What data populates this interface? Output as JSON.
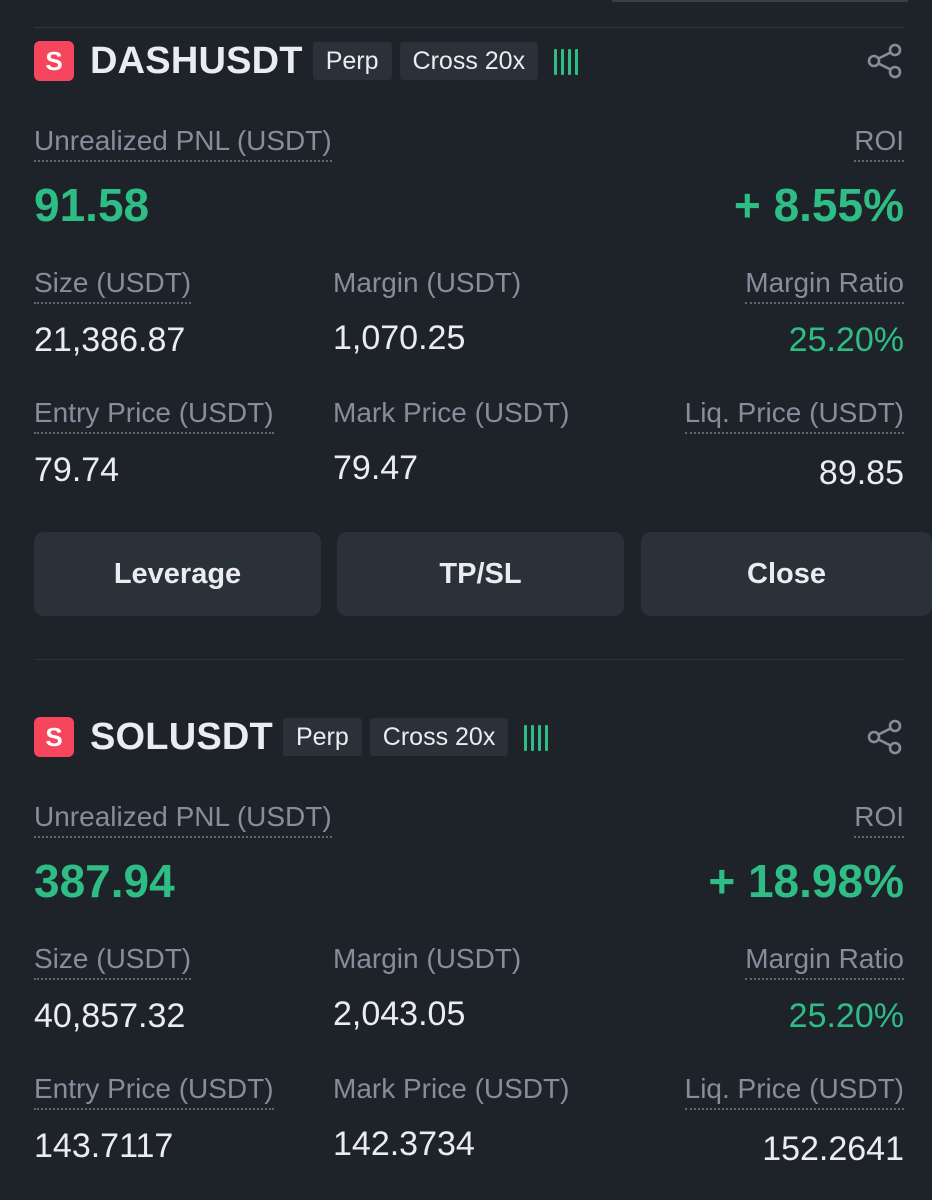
{
  "colors": {
    "background": "#1e2329",
    "positive": "#2ebd85",
    "short_badge": "#f6465d",
    "label": "#848e9c",
    "chip": "#2b3139"
  },
  "positions": [
    {
      "side": "S",
      "symbol": "DASHUSDT",
      "type_tag": "Perp",
      "margin_tag": "Cross 20x",
      "signal_bars": 4,
      "share_icon": "share-icon",
      "pnl_label": "Unrealized PNL (USDT)",
      "pnl": "91.58",
      "roi_label": "ROI",
      "roi": "+ 8.55%",
      "size_label": "Size (USDT)",
      "size": "21,386.87",
      "margin_label": "Margin (USDT)",
      "margin": "1,070.25",
      "margin_ratio_label": "Margin Ratio",
      "margin_ratio": "25.20%",
      "entry_label": "Entry Price (USDT)",
      "entry": "79.74",
      "mark_label": "Mark Price (USDT)",
      "mark": "79.47",
      "liq_label": "Liq. Price (USDT)",
      "liq": "89.85",
      "buttons": {
        "leverage": "Leverage",
        "tpsl": "TP/SL",
        "close": "Close"
      }
    },
    {
      "side": "S",
      "symbol": "SOLUSDT",
      "type_tag": "Perp",
      "margin_tag": "Cross 20x",
      "signal_bars": 4,
      "share_icon": "share-icon",
      "pnl_label": "Unrealized PNL (USDT)",
      "pnl": "387.94",
      "roi_label": "ROI",
      "roi": "+ 18.98%",
      "size_label": "Size (USDT)",
      "size": "40,857.32",
      "margin_label": "Margin (USDT)",
      "margin": "2,043.05",
      "margin_ratio_label": "Margin Ratio",
      "margin_ratio": "25.20%",
      "entry_label": "Entry Price (USDT)",
      "entry": "143.7117",
      "mark_label": "Mark Price (USDT)",
      "mark": "142.3734",
      "liq_label": "Liq. Price (USDT)",
      "liq": "152.2641"
    }
  ]
}
